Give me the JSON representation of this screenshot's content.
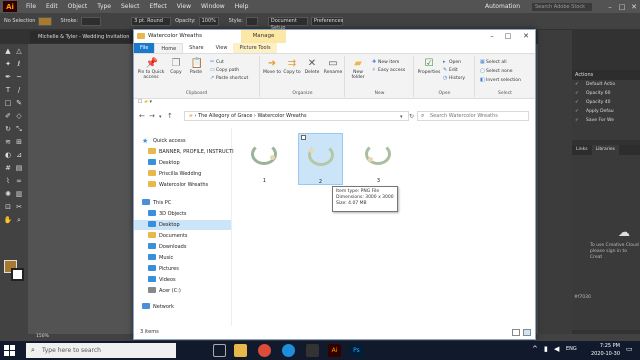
{
  "illustrator": {
    "logo": "Ai",
    "menus": [
      "File",
      "Edit",
      "Object",
      "Type",
      "Select",
      "Effect",
      "View",
      "Window",
      "Help"
    ],
    "workspace": "Automation",
    "search_placeholder": "Search Adobe Stock",
    "control_bar": {
      "selection": "No Selection",
      "stroke_label": "Stroke:",
      "brush": "3 pt. Round",
      "opacity_label": "Opacity:",
      "opacity_value": "100%",
      "style_label": "Style:",
      "document_setup": "Document Setup",
      "preferences": "Preferences"
    },
    "document_tab": "Michelle & Tyler - Wedding Invitation",
    "zoom": "150%",
    "actions_panel": {
      "title": "Actions",
      "items": [
        "Default Actio",
        "Opacity 60",
        "Opacity 40",
        "Apply Defau",
        "Save For We"
      ]
    },
    "libraries_panel": {
      "tabs": [
        "Links",
        "Libraries"
      ],
      "message": "To use Creative Cloud please sign in to Creat"
    },
    "panel_value": "#f7030"
  },
  "explorer": {
    "title": "Watercolor Wreaths",
    "manage_tab": "Manage",
    "tabs": [
      "File",
      "Home",
      "Share",
      "View",
      "Picture Tools"
    ],
    "ribbon": {
      "clipboard": {
        "label": "Clipboard",
        "pin": "Pin to Quick access",
        "copy": "Copy",
        "paste": "Paste",
        "cut": "Cut",
        "copy_path": "Copy path",
        "paste_shortcut": "Paste shortcut"
      },
      "organize": {
        "label": "Organize",
        "move_to": "Move to",
        "copy_to": "Copy to",
        "delete": "Delete",
        "rename": "Rename"
      },
      "new": {
        "label": "New",
        "new_folder": "New folder",
        "new_item": "New item",
        "easy_access": "Easy access"
      },
      "open": {
        "label": "Open",
        "properties": "Properties",
        "open": "Open",
        "edit": "Edit",
        "history": "History"
      },
      "select": {
        "label": "Select",
        "select_all": "Select all",
        "select_none": "Select none",
        "invert": "Invert selection"
      }
    },
    "address": {
      "root": "The Allegory of Grace",
      "folder": "Watercolor Wreaths"
    },
    "search_placeholder": "Search Watercolor Wreaths",
    "nav": {
      "quick_access": "Quick access",
      "items": [
        "BANNER, PROFILE, INSTRUCTI",
        "Desktop",
        "Priscilla Wedding",
        "Watercolor Wreaths"
      ],
      "this_pc": "This PC",
      "pc_items": [
        "3D Objects",
        "Desktop",
        "Documents",
        "Downloads",
        "Music",
        "Pictures",
        "Videos",
        "Acer (C:)"
      ],
      "network": "Network"
    },
    "files": [
      {
        "name": "1"
      },
      {
        "name": "2"
      },
      {
        "name": "3"
      }
    ],
    "tooltip": {
      "type": "Item type: PNG File",
      "dimensions": "Dimensions: 3000 x 3000",
      "size": "Size: 4.07 MB"
    },
    "status": "3 items"
  },
  "taskbar": {
    "search_placeholder": "Type here to search",
    "language": "ENG",
    "time": "7:25 PM",
    "date": "2020-10-30"
  }
}
